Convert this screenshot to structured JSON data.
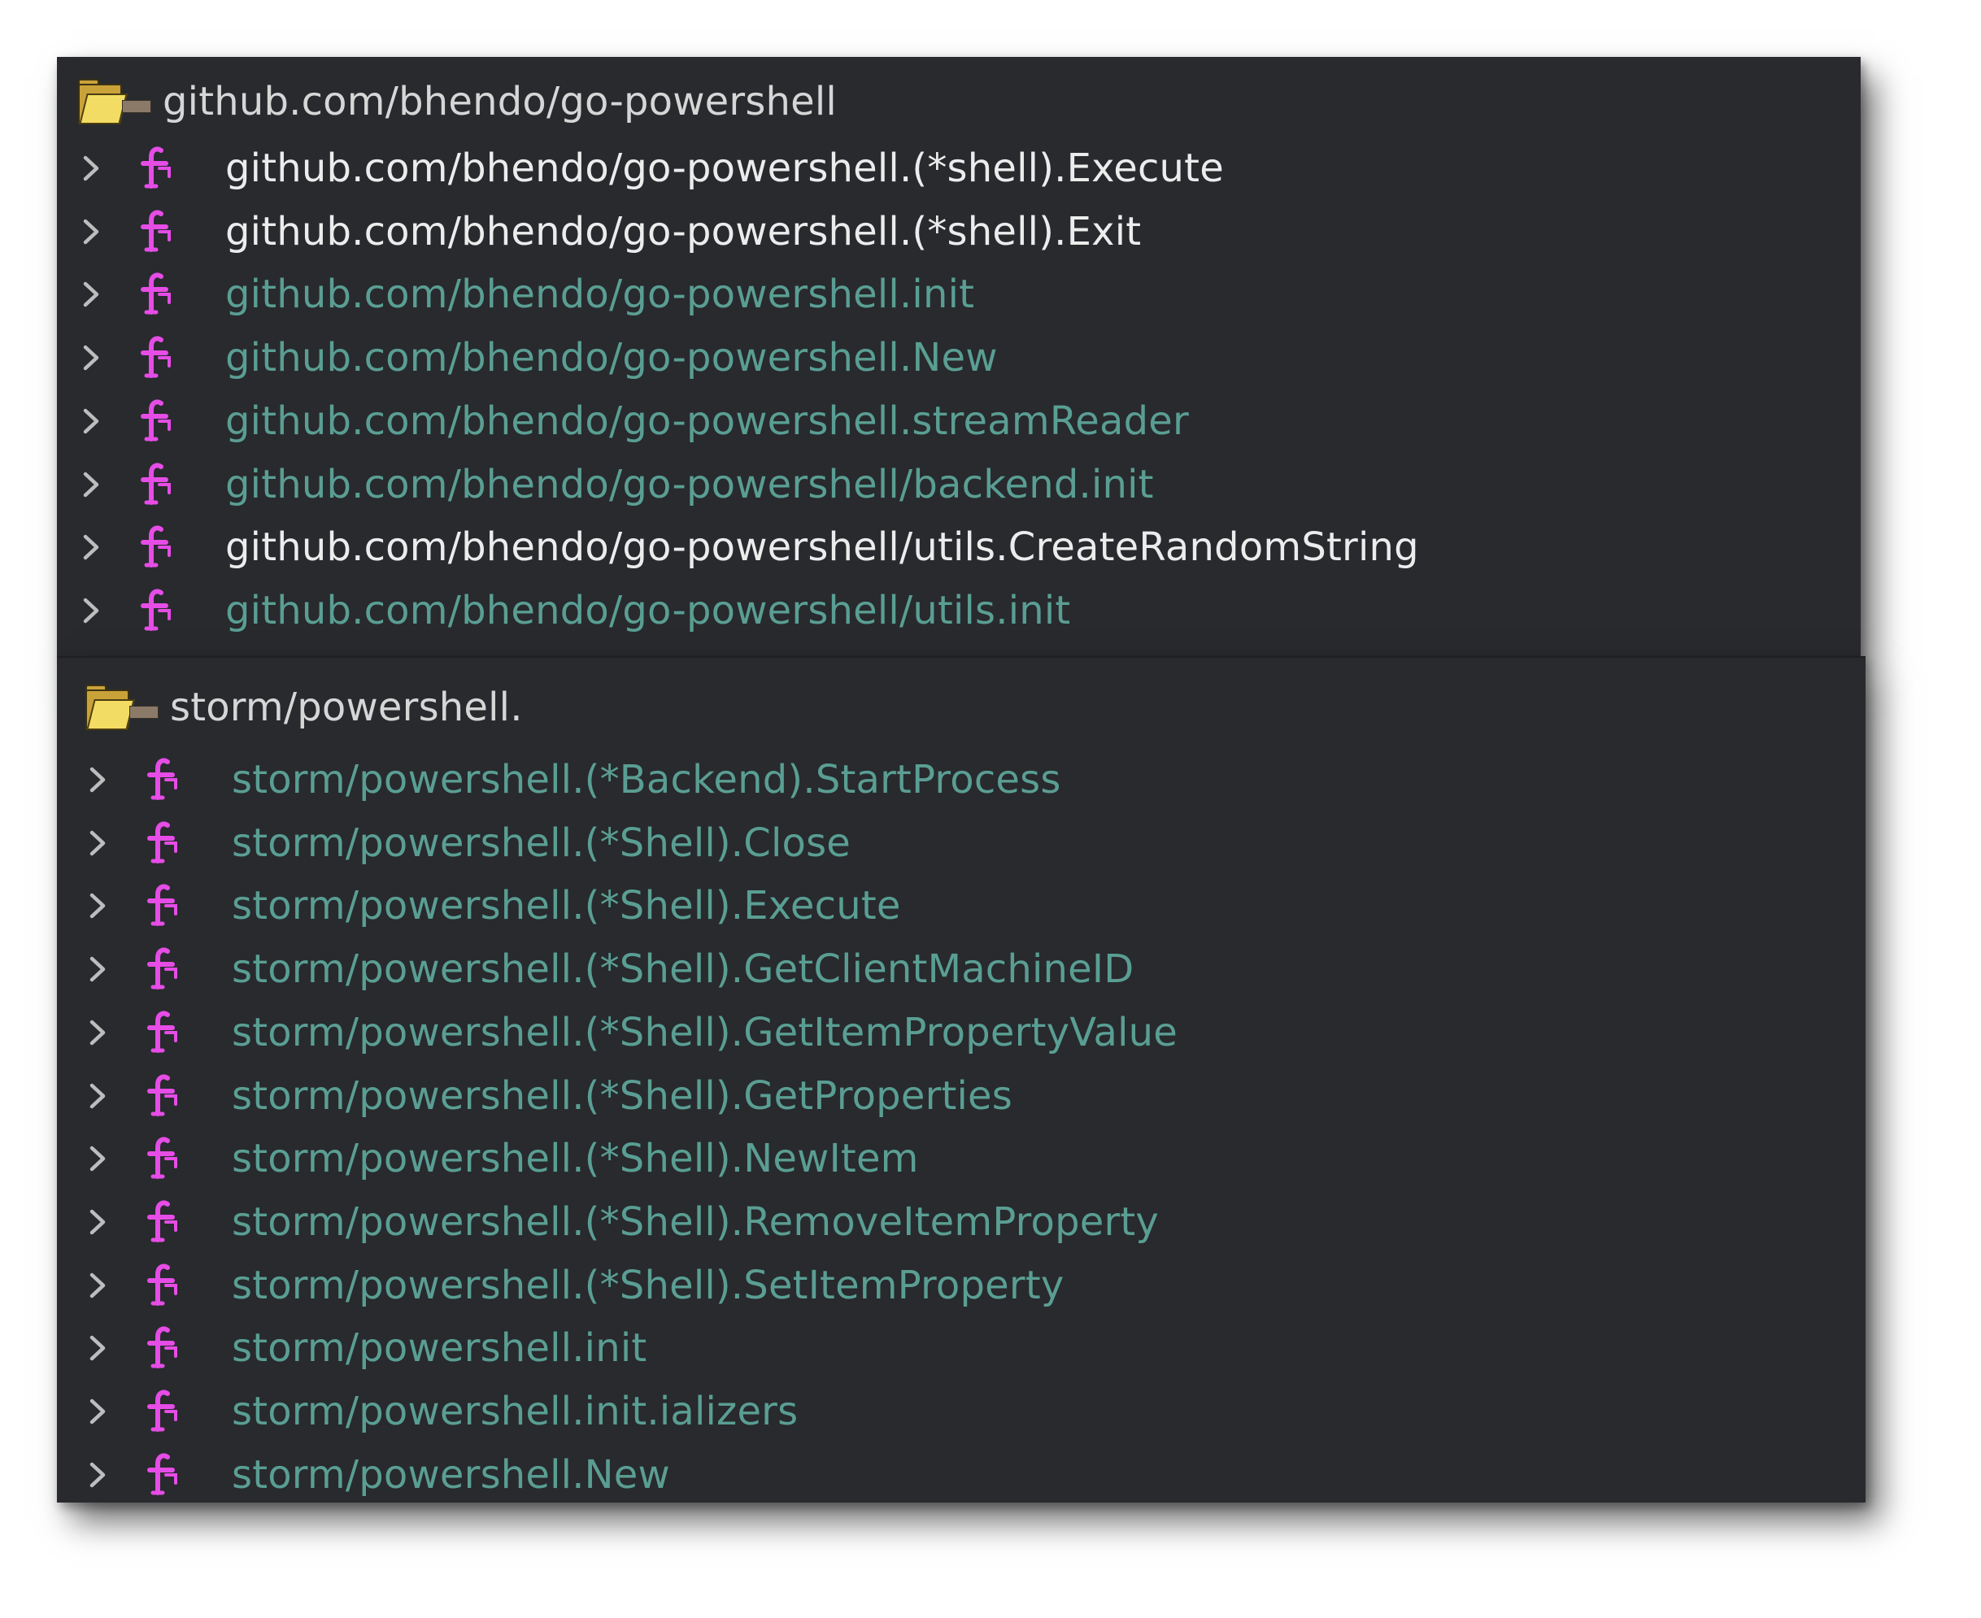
{
  "groups": [
    {
      "title": "github.com/bhendo/go-powershell",
      "icon": "folder-icon",
      "items": [
        {
          "label": "github.com/bhendo/go-powershell.(*shell).Execute",
          "highlighted": true
        },
        {
          "label": "github.com/bhendo/go-powershell.(*shell).Exit",
          "highlighted": true
        },
        {
          "label": "github.com/bhendo/go-powershell.init",
          "highlighted": false
        },
        {
          "label": "github.com/bhendo/go-powershell.New",
          "highlighted": false
        },
        {
          "label": "github.com/bhendo/go-powershell.streamReader",
          "highlighted": false
        },
        {
          "label": "github.com/bhendo/go-powershell/backend.init",
          "highlighted": false
        },
        {
          "label": "github.com/bhendo/go-powershell/utils.CreateRandomString",
          "highlighted": true
        },
        {
          "label": "github.com/bhendo/go-powershell/utils.init",
          "highlighted": false
        }
      ]
    },
    {
      "title": "storm/powershell.",
      "icon": "folder-icon",
      "items": [
        {
          "label": "storm/powershell.(*Backend).StartProcess",
          "highlighted": false
        },
        {
          "label": "storm/powershell.(*Shell).Close",
          "highlighted": false
        },
        {
          "label": "storm/powershell.(*Shell).Execute",
          "highlighted": false
        },
        {
          "label": "storm/powershell.(*Shell).GetClientMachineID",
          "highlighted": false
        },
        {
          "label": "storm/powershell.(*Shell).GetItemPropertyValue",
          "highlighted": false
        },
        {
          "label": "storm/powershell.(*Shell).GetProperties",
          "highlighted": false
        },
        {
          "label": "storm/powershell.(*Shell).NewItem",
          "highlighted": false
        },
        {
          "label": "storm/powershell.(*Shell).RemoveItemProperty",
          "highlighted": false
        },
        {
          "label": "storm/powershell.(*Shell).SetItemProperty",
          "highlighted": false
        },
        {
          "label": "storm/powershell.init",
          "highlighted": false
        },
        {
          "label": "storm/powershell.init.ializers",
          "highlighted": false
        },
        {
          "label": "storm/powershell.New",
          "highlighted": false
        }
      ]
    }
  ],
  "colors": {
    "panel_background": "#282a2e",
    "text_dim": "#5a9e93",
    "text_bright": "#ececec",
    "header_text": "#d6d6d6",
    "function_icon": "#e64ce6",
    "chevron": "#bdbdbd"
  },
  "icons": {
    "expand": "chevron-right-icon",
    "function": "function-icon",
    "group": "folder-icon"
  }
}
